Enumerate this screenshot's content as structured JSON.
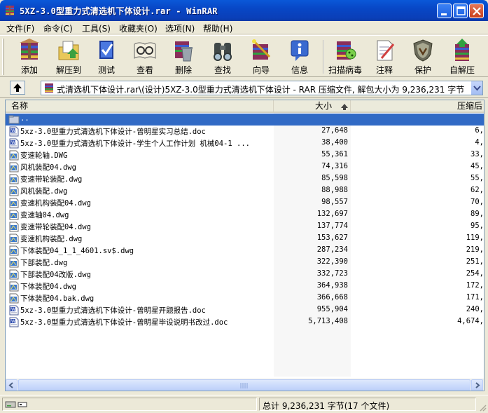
{
  "window": {
    "title": "5XZ-3.0型重力式清选机下体设计.rar - WinRAR",
    "minimize": "minimize",
    "maximize": "maximize",
    "close": "close"
  },
  "menu": [
    {
      "label": "文件(F)"
    },
    {
      "label": "命令(C)"
    },
    {
      "label": "工具(S)"
    },
    {
      "label": "收藏夹(O)"
    },
    {
      "label": "选项(N)"
    },
    {
      "label": "帮助(H)"
    }
  ],
  "toolbar": [
    {
      "label": "添加",
      "icon": "add-archive-icon"
    },
    {
      "label": "解压到",
      "icon": "extract-to-icon"
    },
    {
      "label": "测试",
      "icon": "test-icon"
    },
    {
      "label": "查看",
      "icon": "view-icon"
    },
    {
      "label": "删除",
      "icon": "delete-icon"
    },
    {
      "label": "查找",
      "icon": "find-icon"
    },
    {
      "label": "向导",
      "icon": "wizard-icon"
    },
    {
      "label": "信息",
      "icon": "info-icon"
    },
    {
      "label": "扫描病毒",
      "icon": "virus-scan-icon"
    },
    {
      "label": "注释",
      "icon": "comment-icon"
    },
    {
      "label": "保护",
      "icon": "protect-icon"
    },
    {
      "label": "自解压",
      "icon": "sfx-icon"
    }
  ],
  "address": {
    "path": "式清选机下体设计.rar\\(设计)5XZ-3.0型重力式清选机下体设计 - RAR 压缩文件, 解包大小为 9,236,231 字节"
  },
  "columns": {
    "name": "名称",
    "size": "大小",
    "packed": "压缩后"
  },
  "files": [
    {
      "name": "..",
      "size": "",
      "packed": "",
      "type": "folder-up"
    },
    {
      "name": "5xz-3.0型重力式清选机下体设计-曾明星实习总结.doc",
      "size": "27,648",
      "packed": "6,",
      "type": "doc"
    },
    {
      "name": "5xz-3.0型重力式清选机下体设计-学生个人工作计划  机械04-1 ...",
      "size": "38,400",
      "packed": "4,",
      "type": "doc"
    },
    {
      "name": "变速轮轴.DWG",
      "size": "55,361",
      "packed": "33,",
      "type": "dwg"
    },
    {
      "name": "风机装配04.dwg",
      "size": "74,316",
      "packed": "45,",
      "type": "dwg"
    },
    {
      "name": "变速带轮装配.dwg",
      "size": "85,598",
      "packed": "55,",
      "type": "dwg"
    },
    {
      "name": "风机装配.dwg",
      "size": "88,988",
      "packed": "62,",
      "type": "dwg"
    },
    {
      "name": "变速机构装配04.dwg",
      "size": "98,557",
      "packed": "70,",
      "type": "dwg"
    },
    {
      "name": "变速轴04.dwg",
      "size": "132,697",
      "packed": "89,",
      "type": "dwg"
    },
    {
      "name": "变速带轮装配04.dwg",
      "size": "137,774",
      "packed": "95,",
      "type": "dwg"
    },
    {
      "name": "变速机构装配.dwg",
      "size": "153,627",
      "packed": "119,",
      "type": "dwg"
    },
    {
      "name": "下体装配04_1_1_4601.sv$.dwg",
      "size": "287,234",
      "packed": "219,",
      "type": "dwg"
    },
    {
      "name": "下部装配.dwg",
      "size": "322,390",
      "packed": "251,",
      "type": "dwg"
    },
    {
      "name": "下部装配04改版.dwg",
      "size": "332,723",
      "packed": "254,",
      "type": "dwg"
    },
    {
      "name": "下体装配04.dwg",
      "size": "364,938",
      "packed": "172,",
      "type": "dwg"
    },
    {
      "name": "下体装配04.bak.dwg",
      "size": "366,668",
      "packed": "171,",
      "type": "dwg"
    },
    {
      "name": "5xz-3.0型重力式清选机下体设计-曾明星开题报告.doc",
      "size": "955,904",
      "packed": "240,",
      "type": "doc"
    },
    {
      "name": "5xz-3.0型重力式清选机下体设计-曾明星毕设说明书改过.doc",
      "size": "5,713,408",
      "packed": "4,674,",
      "type": "doc"
    }
  ],
  "status": {
    "total": "总计 9,236,231 字节(17 个文件)"
  },
  "colors": {
    "titlebar": "#0a4fd0",
    "selection": "#316ac5",
    "chrome": "#ece9d8"
  }
}
